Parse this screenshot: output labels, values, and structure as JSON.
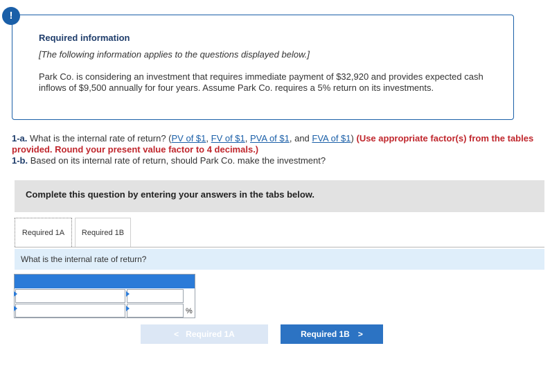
{
  "alert": {
    "icon": "exclamation-icon",
    "symbol": "!"
  },
  "info": {
    "title": "Required information",
    "note": "[The following information applies to the questions displayed below.]",
    "body": "Park Co. is considering an investment that requires immediate payment of $32,920 and provides expected cash inflows of $9,500 annually for four years. Assume Park Co. requires a 5% return on its investments."
  },
  "questions": {
    "q1a_label": "1-a.",
    "q1a_text": " What is the internal rate of return? (",
    "links": {
      "pv": "PV of $1",
      "fv": "FV of $1",
      "pva": "PVA of $1",
      "fva": "FVA of $1"
    },
    "sep1": ", ",
    "sep2": ", ",
    "sep3": ", and ",
    "close": ") ",
    "instruction": "(Use appropriate factor(s) from the tables provided. Round your present value factor to 4 decimals.)",
    "q1b_label": "1-b.",
    "q1b_text": " Based on its internal rate of return, should Park Co. make the investment?"
  },
  "complete_text": "Complete this question by entering your answers in the tabs below.",
  "tabs": [
    {
      "label": "Required 1A",
      "active": true
    },
    {
      "label": "Required 1B",
      "active": false
    }
  ],
  "prompt": "What is the internal rate of return?",
  "answer": {
    "row1_left": "",
    "row1_right": "",
    "row2_left": "",
    "row2_right": "",
    "unit": "%"
  },
  "nav": {
    "prev_label": "Required 1A",
    "next_label": "Required 1B",
    "prev_icon": "chevron-left-icon",
    "next_icon": "chevron-right-icon"
  },
  "colors": {
    "accent": "#1a5fa8",
    "button": "#2c73c3",
    "button_disabled": "#dce7f5",
    "instruction_red": "#c0272d",
    "prompt_bg": "#dfeefa"
  }
}
